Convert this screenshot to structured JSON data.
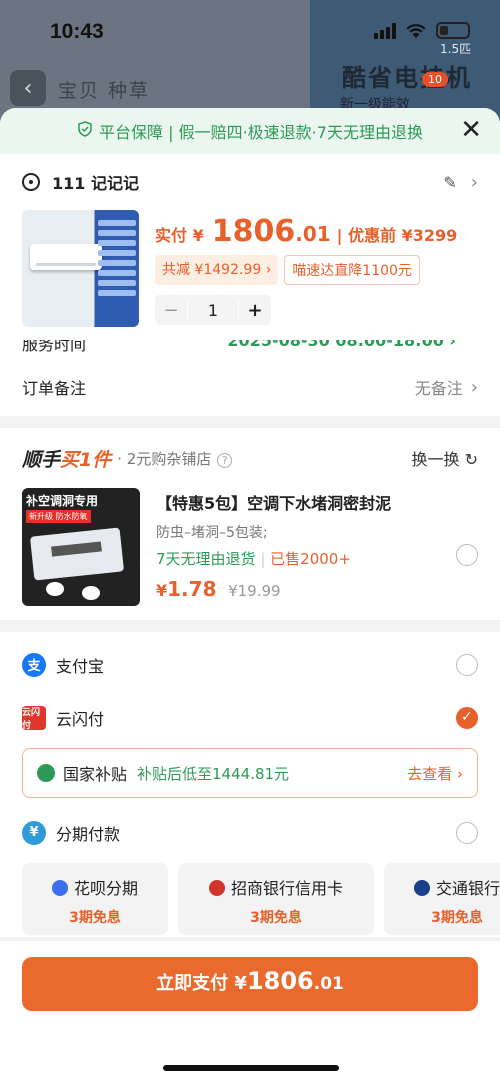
{
  "status": {
    "time": "10:43"
  },
  "background_app": {
    "tabs": "宝贝   种草",
    "title": "酷省电挂机",
    "subtitle": "新一级能效",
    "cart_count": "10",
    "version_hint": "1.5匹"
  },
  "guarantee": {
    "text": "平台保障 | 假一赔四·极速退款·7天无理由退换"
  },
  "address": {
    "name": "111 记记记"
  },
  "product": {
    "paid_label": "实付 ¥",
    "price_int": "1806",
    "price_dec": ".01",
    "before_label": "| 优惠前 ¥3299",
    "discount_tag": "共减 ¥1492.99 ›",
    "promo_tag": "喵速达直降1100元",
    "quantity": "1",
    "minus": "−",
    "plus": "+"
  },
  "service_time": {
    "label": "服务时间",
    "value": "2025-08-30 08:00-18:00 ›"
  },
  "order_note": {
    "label": "订单备注",
    "value": "无备注"
  },
  "extra": {
    "title_a": "顺手",
    "title_b": "买1件",
    "sub": "· 2元购杂铺店",
    "swap": "换一换 ↻",
    "image_header": "补空调洞专用",
    "image_badge": "新升级 防水防氧",
    "name": "【特惠5包】空调下水堵洞密封泥",
    "desc": "防虫–堵洞–5包装;",
    "return_policy": "7天无理由退货",
    "sold": "已售2000+",
    "price_int": "1.78",
    "price_sym": "¥",
    "old_price": "¥19.99"
  },
  "payment": {
    "alipay": "支付宝",
    "unionpay": "云闪付",
    "subsidy": {
      "name": "国家补贴",
      "highlight": "补贴后低至1444.81元",
      "action": "去查看 ›"
    },
    "installment": "分期付款",
    "plans": [
      {
        "name": "花呗分期",
        "note": "3期免息",
        "color": "#3a6ff0"
      },
      {
        "name": "招商银行信用卡",
        "note": "3期免息",
        "color": "#d0342c"
      },
      {
        "name": "交通银行",
        "note": "3期免息",
        "color": "#1a3f8a"
      }
    ]
  },
  "pay_button": {
    "label": "立即支付 ¥",
    "amount_int": "1806",
    "amount_dec": ".01"
  },
  "colors": {
    "accent": "#e96a2c",
    "green": "#2e9a57",
    "alipay_blue": "#1677ff",
    "unionpay_red": "#e0372c"
  }
}
